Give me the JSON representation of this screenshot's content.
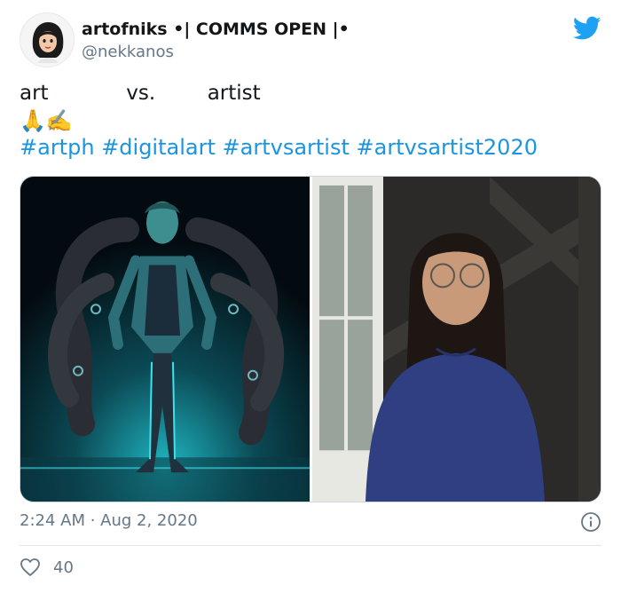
{
  "user": {
    "display_name": "artofniks •| COMMS OPEN |•",
    "handle": "@nekkanos"
  },
  "tweet": {
    "line1": "art            vs.        artist",
    "emojis": "🙏✍️",
    "hashtags": [
      "#artph",
      "#digitalart",
      "#artvsartist",
      "#artvsartist2020"
    ],
    "timestamp": "2:24 AM · Aug 2, 2020",
    "likes": "40"
  },
  "icons": {
    "brand": "twitter-bird-icon",
    "info": "info-icon",
    "like": "heart-icon"
  },
  "colors": {
    "link": "#1b95e0",
    "twitter_blue": "#1da1f2",
    "secondary_text": "#657786"
  }
}
